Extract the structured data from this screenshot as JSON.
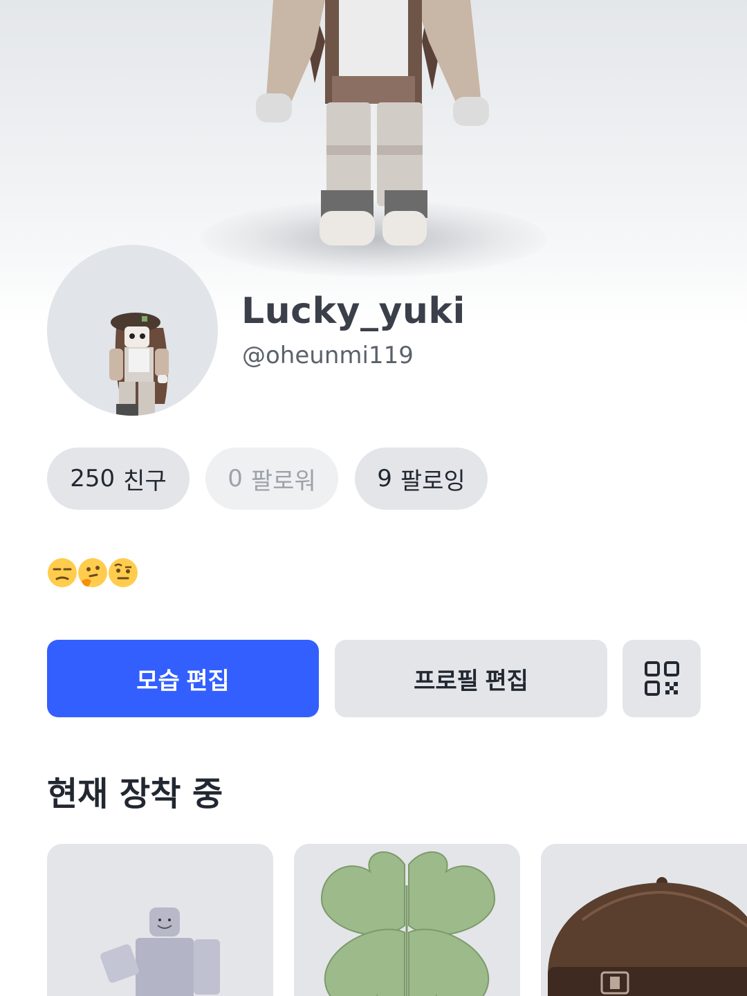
{
  "profile": {
    "display_name": "Lucky_yuki",
    "username": "@oheunmi119"
  },
  "stats": {
    "friends": {
      "count": "250",
      "label": "친구"
    },
    "followers": {
      "count": "0",
      "label": "팔로워"
    },
    "following": {
      "count": "9",
      "label": "팔로잉"
    }
  },
  "bio": {
    "emojis": [
      "unamused-face",
      "thinking-face",
      "face-with-raised-eyebrow"
    ]
  },
  "actions": {
    "edit_avatar_label": "모습 편집",
    "edit_profile_label": "프로필 편집",
    "qr_icon": "qr-code-icon"
  },
  "currently_wearing": {
    "title": "현재 장착 중",
    "items": [
      {
        "icon": "default-avatar-figure"
      },
      {
        "icon": "four-leaf-clover"
      },
      {
        "icon": "brown-newsboy-cap"
      }
    ]
  },
  "colors": {
    "accent": "#335fff",
    "chip_bg": "#e3e5e9",
    "text_primary": "#222831"
  }
}
